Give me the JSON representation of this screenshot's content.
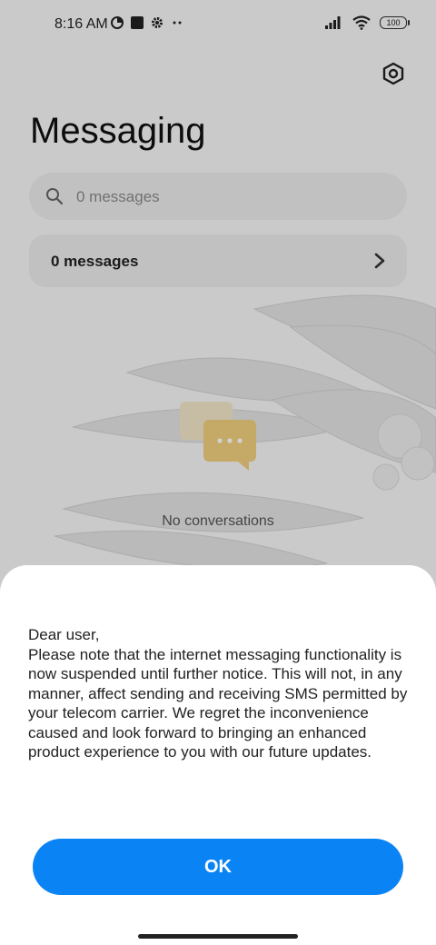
{
  "status_bar": {
    "time": "8:16 AM",
    "battery": "100",
    "left_icons": [
      "data-saver-icon",
      "stop-square-icon",
      "gear-icon",
      "more-dots-icon"
    ],
    "right_icons": [
      "signal-icon",
      "wifi-icon",
      "battery-icon"
    ]
  },
  "header": {
    "title": "Messaging",
    "settings_icon": "hexagon-settings-icon"
  },
  "search": {
    "placeholder": "0 messages"
  },
  "messages_card": {
    "label": "0 messages"
  },
  "empty_state": {
    "text": "No conversations",
    "icon": "chat-bubbles-icon"
  },
  "dialog": {
    "message": "Dear user,\nPlease note that the internet messaging functionality is now suspended until further notice. This will not, in any manner, affect sending and receiving SMS permitted by your telecom carrier. We regret the inconvenience caused and look forward to bringing an enhanced product experience to you with our future updates.",
    "ok_label": "OK"
  },
  "colors": {
    "accent": "#0A84F5",
    "sheet_bg": "#FFFFFF",
    "app_bg": "#F7F7F7"
  }
}
